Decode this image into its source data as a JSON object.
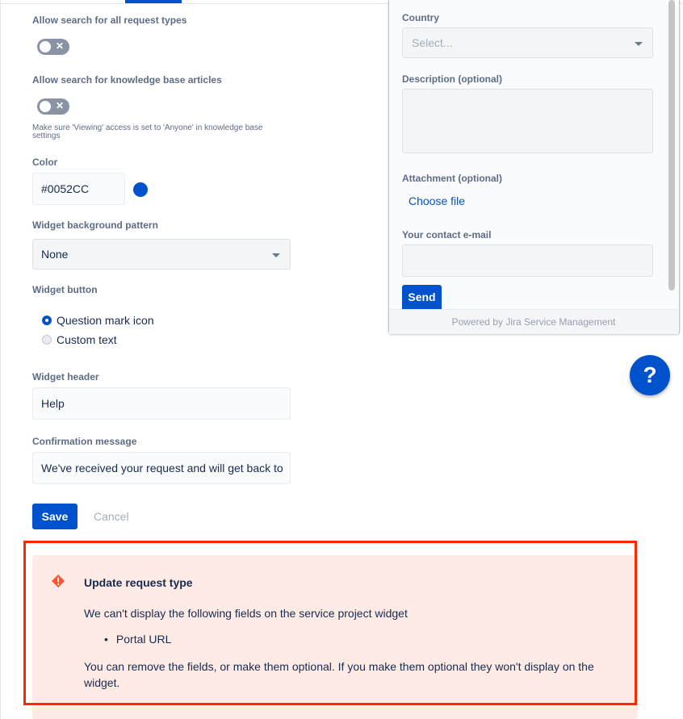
{
  "settings": {
    "search_all_label": "Allow search for all request types",
    "search_all_on": false,
    "search_kb_label": "Allow search for knowledge base articles",
    "search_kb_on": false,
    "kb_help": "Make sure 'Viewing' access is set to 'Anyone' in knowledge base settings",
    "color_label": "Color",
    "color_value": "#0052CC",
    "pattern_label": "Widget background pattern",
    "pattern_value": "None",
    "button_label": "Widget button",
    "button_options": [
      {
        "label": "Question mark icon",
        "selected": true
      },
      {
        "label": "Custom text",
        "selected": false
      }
    ],
    "header_label": "Widget header",
    "header_value": "Help",
    "confirm_label": "Confirmation message",
    "confirm_value": "We've received your request and will get back to",
    "save": "Save",
    "cancel": "Cancel"
  },
  "widget": {
    "country_label": "Country",
    "country_placeholder": "Select...",
    "description_label": "Description (optional)",
    "attachment_label": "Attachment (optional)",
    "choose_file": "Choose file",
    "email_label": "Your contact e-mail",
    "send": "Send",
    "footer": "Powered by Jira Service Management",
    "help_button": "?"
  },
  "alert": {
    "icon": "error-icon",
    "title": "Update request type",
    "message": "We can't display the following fields on the service project widget",
    "fields": [
      "Portal URL"
    ],
    "footer": "You can remove the fields, or make them optional. If you make them optional they won't display on the widget."
  },
  "colors": {
    "accent": "#0052CC",
    "alert_bg": "#FFEBE6",
    "alert_icon": "#FF5630",
    "highlight": "#FF2600"
  }
}
